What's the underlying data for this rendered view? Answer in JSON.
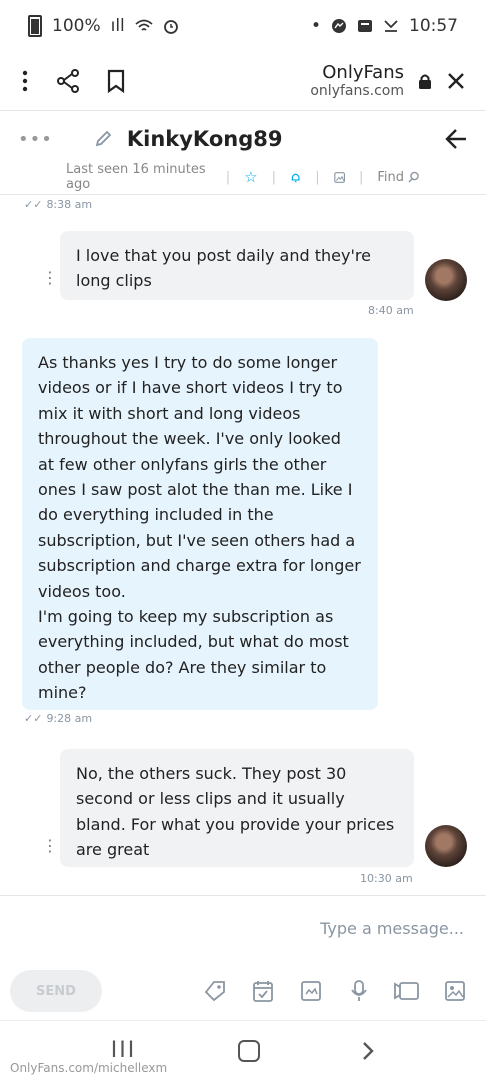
{
  "status_bar": {
    "time": "10:57",
    "battery_text": "100%",
    "signal_text": "ıll"
  },
  "browser": {
    "site_name": "OnlyFans",
    "site_domain": "onlyfans.com"
  },
  "chat": {
    "username": "KinkyKong89",
    "last_seen": "Last seen 16 minutes ago",
    "find_label": "Find",
    "messages": [
      {
        "time": "8:38 am"
      },
      {
        "text": "I love that you post daily and they're long clips",
        "time": "8:40 am"
      },
      {
        "text": "As thanks yes I try to do some longer videos or if I have short videos I try to mix it with short and long videos throughout the week. I've only looked at few other onlyfans girls the other ones I saw post alot the than me. Like I do everything included in the subscription, but I've seen others had a subscription and charge extra for longer videos too.\nI'm going to keep my subscription as everything included, but what do most other people do? Are they similar to mine?",
        "time": "9:28 am"
      },
      {
        "text": "No, the others suck. They post 30 second or less clips and it usually bland. For what you provide your prices are great",
        "time": "10:30 am"
      }
    ]
  },
  "composer": {
    "placeholder": "Type a message...",
    "send_label": "SEND"
  },
  "watermark": "OnlyFans.com/michellexm",
  "colors": {
    "accent": "#00aff0",
    "incoming_bg": "#f1f2f4",
    "outgoing_bg": "#e6f4fd"
  }
}
